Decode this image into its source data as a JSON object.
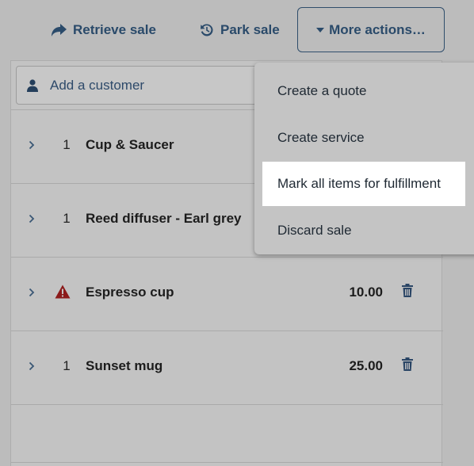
{
  "toolbar": {
    "retrieve_label": "Retrieve sale",
    "park_label": "Park sale",
    "more_label": "More actions…"
  },
  "customer": {
    "label": "Add a customer"
  },
  "line_items": [
    {
      "qty": "1",
      "name": "Cup & Saucer",
      "price": ""
    },
    {
      "qty": "1",
      "name": "Reed diffuser - Earl grey",
      "price": ""
    },
    {
      "qty": "",
      "name": "Espresso cup",
      "price": "10.00",
      "warning": true
    },
    {
      "qty": "1",
      "name": "Sunset mug",
      "price": "25.00"
    }
  ],
  "menu": {
    "items": [
      {
        "label": "Create a quote"
      },
      {
        "label": "Create service"
      },
      {
        "label": "Mark all items for fulfillment",
        "highlighted": true
      },
      {
        "label": "Discard sale"
      }
    ]
  },
  "colors": {
    "accent": "#2a4a6a",
    "warning": "#8b1a1a",
    "highlight": "#ffffff"
  }
}
